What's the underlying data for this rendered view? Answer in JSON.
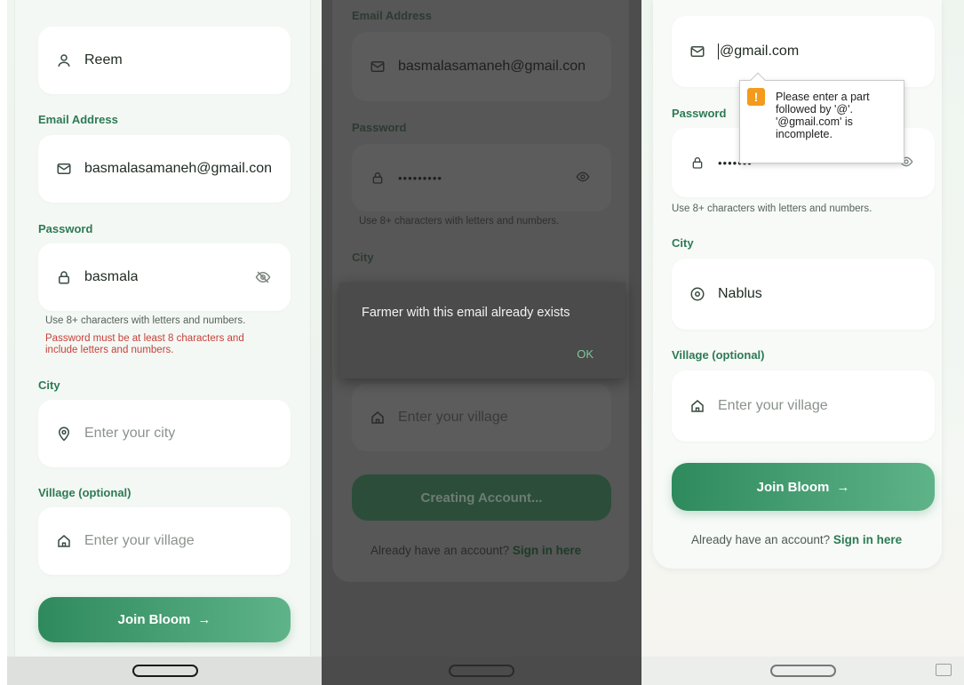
{
  "panel1": {
    "name_field": {
      "value": "Reem",
      "icon": "user-icon"
    },
    "email_label": "Email Address",
    "email_field": {
      "value": "basmalasamaneh@gmail.con",
      "icon": "mail-icon"
    },
    "password_label": "Password",
    "password_field": {
      "value": "basmala",
      "icon": "lock-icon",
      "toggle_icon": "eye-off-icon"
    },
    "password_hint": "Use 8+ characters with letters and numbers.",
    "password_error_line1": "Password must be at least 8 characters and",
    "password_error_line2": "include letters and numbers.",
    "city_label": "City",
    "city_field": {
      "placeholder": "Enter your city",
      "icon": "location-icon"
    },
    "village_label": "Village (optional)",
    "village_field": {
      "placeholder": "Enter your village",
      "icon": "home-icon"
    },
    "submit_label": "Join Bloom",
    "submit_arrow": "→"
  },
  "panel2": {
    "email_label": "Email Address",
    "email_field": {
      "value": "basmalasamaneh@gmail.con",
      "icon": "mail-icon"
    },
    "password_label": "Password",
    "password_field": {
      "value": "•••••••••",
      "icon": "lock-icon",
      "toggle_icon": "eye-icon"
    },
    "password_hint": "Use 8+ characters with letters and numbers.",
    "city_label": "City",
    "village_field": {
      "placeholder": "Enter your village",
      "icon": "home-icon"
    },
    "submit_label": "Creating Account...",
    "signin_text": "Already have an account?",
    "signin_link": "Sign in here",
    "dialog": {
      "message": "Farmer with this email already exists",
      "ok_label": "OK"
    }
  },
  "panel3": {
    "email_field": {
      "value": "@gmail.com",
      "icon": "mail-icon"
    },
    "tooltip": {
      "line1": "Please enter a part",
      "line2": "followed by '@'.",
      "line3": "'@gmail.com' is",
      "line4": "incomplete."
    },
    "password_label": "Password",
    "password_field": {
      "value": "•••••••",
      "icon": "lock-icon",
      "toggle_icon": "eye-icon"
    },
    "password_hint": "Use 8+ characters with letters and numbers.",
    "city_label": "City",
    "city_field": {
      "value": "Nablus",
      "icon": "location-icon"
    },
    "village_label": "Village (optional)",
    "village_field": {
      "placeholder": "Enter your village",
      "icon": "home-icon"
    },
    "submit_label": "Join Bloom",
    "submit_arrow": "→",
    "signin_text": "Already have an account?",
    "signin_link": "Sign in here"
  },
  "colors": {
    "accent": "#2d7a54",
    "button_gradient_start": "#2e8a5c",
    "button_gradient_end": "#5fb389",
    "error": "#c7413b",
    "warning": "#f49a1d"
  }
}
